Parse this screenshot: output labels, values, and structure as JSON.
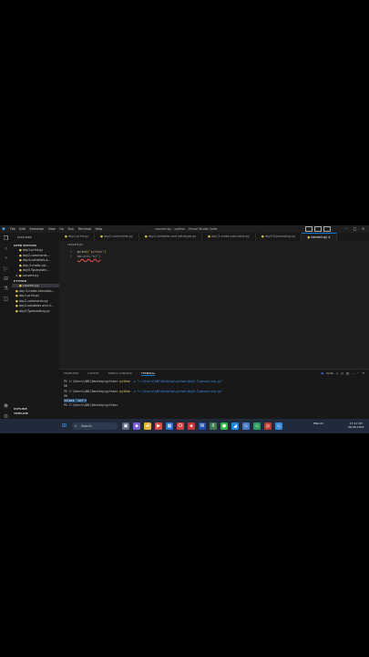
{
  "window": {
    "title": "convert.py - python - Visual Studio Code",
    "menu": [
      "File",
      "Edit",
      "Selection",
      "View",
      "Go",
      "Run",
      "Terminal",
      "Help"
    ]
  },
  "sidebar": {
    "header": "EXPLORER",
    "open_editors_label": "OPEN EDITORS",
    "open_editors": [
      "day1-print.py",
      "day2-comments...",
      "day4-variables-a...",
      "day-3-make-cal...",
      "day5-Typecastin...",
      "convert.py"
    ],
    "folder_label": "PYTHON",
    "files": [
      "convert.py",
      "day-3-make-calculato...",
      "day1-print.py",
      "day2-comments.py",
      "day4-variables and d...",
      "day5-Typecasting.py"
    ],
    "outline_label": "OUTLINE",
    "timeline_label": "TIMELINE"
  },
  "tabs": [
    {
      "label": "day1-print.py"
    },
    {
      "label": "day2-comments.py"
    },
    {
      "label": "day4-variables and datatype.py"
    },
    {
      "label": "day-3-make-calculator.py"
    },
    {
      "label": "day5-Typecasting.py"
    },
    {
      "label": "convert.py"
    }
  ],
  "breadcrumb": "convert.py",
  "editor": {
    "lines": [
      {
        "num": "1",
        "fn": "print",
        "arg": "\"python\""
      },
      {
        "num": "2",
        "text": "#print(\"oj\")"
      }
    ]
  },
  "panel": {
    "tabs": [
      "PROBLEMS",
      "OUTPUT",
      "DEBUG CONSOLE",
      "TERMINAL"
    ],
    "shell": "Code",
    "terminal_lines": [
      {
        "prompt": "PS C:\\Users\\ABC\\Desktop\\python>",
        "cmd": "python",
        "arg": "-u \"c:\\Users\\ABC\\Desktop\\python\\day5-Typecasting.py\""
      },
      {
        "text": "56"
      },
      {
        "prompt": "PS C:\\Users\\ABC\\Desktop\\python>",
        "cmd": "python",
        "arg": "-u \"c:\\Users\\ABC\\Desktop\\python\\day5-Typecasting.py\""
      },
      {
        "text": "56"
      },
      {
        "highlight": "<class 'int'>"
      },
      {
        "prompt": "PS C:\\Users\\ABC\\Desktop\\python>"
      }
    ]
  },
  "taskbar": {
    "search_label": "Search",
    "tray_weather": "ENG IN",
    "time": "17:11 IST",
    "date": "06-06-2023"
  },
  "colors": {
    "accent": "#0078d4",
    "editor_bg": "#1e1e1e",
    "sidebar_bg": "#181818",
    "taskbar_bg": "#202a3a"
  }
}
